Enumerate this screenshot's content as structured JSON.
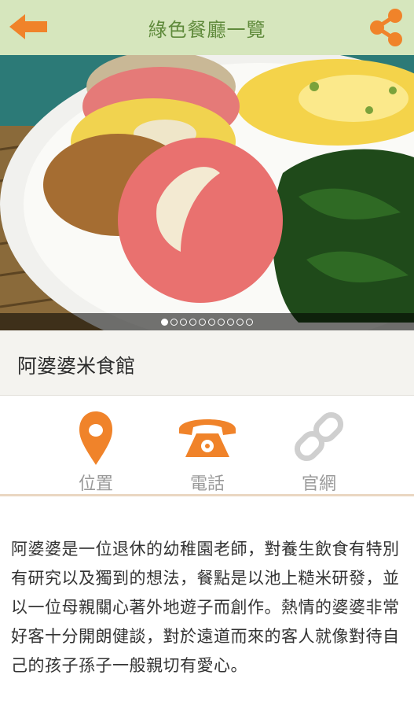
{
  "header": {
    "title": "綠色餐廳一覽",
    "back_icon": "arrow-left-icon",
    "share_icon": "share-icon",
    "accent": "#f0832a",
    "background": "#d6e6bd"
  },
  "carousel": {
    "image_description": "plate of colorful rice rolls with spinach and egg",
    "page_count": 10,
    "current_page": 1
  },
  "restaurant": {
    "name": "阿婆婆米食館"
  },
  "actions": {
    "location_label": "位置",
    "location_icon": "map-pin-icon",
    "phone_label": "電話",
    "phone_icon": "telephone-icon",
    "website_label": "官網",
    "website_icon": "link-icon"
  },
  "description": "阿婆婆是一位退休的幼稚園老師，對養生飲食有特別有研究以及獨到的想法，餐點是以池上糙米研發，並以一位母親關心著外地遊子而創作。熱情的婆婆非常好客十分開朗健談，對於遠道而來的客人就像對待自己的孩子孫子一般親切有愛心。"
}
